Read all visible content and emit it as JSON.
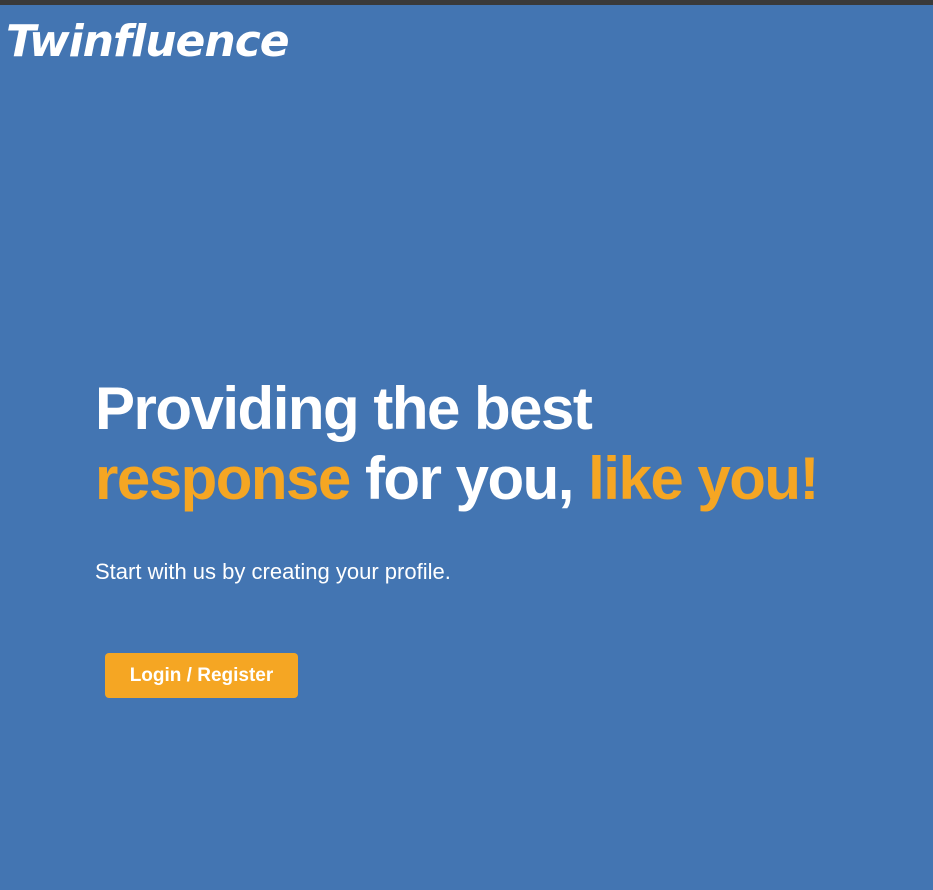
{
  "brand": {
    "name": "Twinfluence"
  },
  "hero": {
    "line1": "Providing the best",
    "line2_accent_1": "response",
    "line2_plain": " for you, ",
    "line2_accent_2": "like you!",
    "subtitle": "Start with us by creating your profile."
  },
  "cta": {
    "label": "Login / Register"
  },
  "colors": {
    "background": "#4375b2",
    "accent": "#f5a623",
    "text": "#ffffff"
  }
}
